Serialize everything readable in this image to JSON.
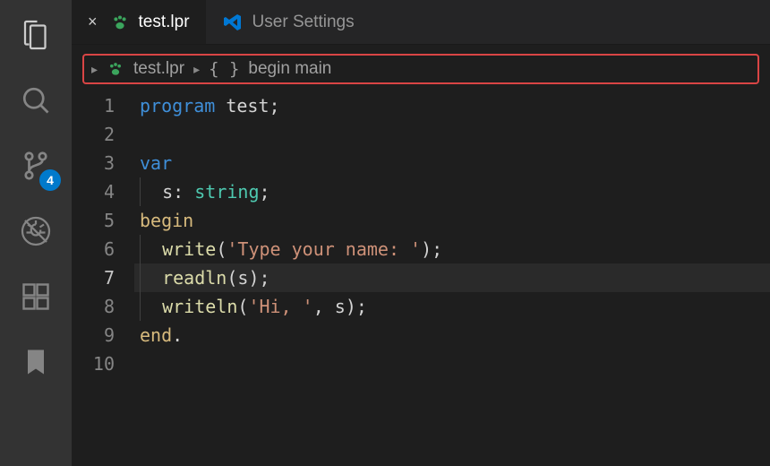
{
  "activity": {
    "scm_badge": "4"
  },
  "tabs": {
    "active": {
      "label": "test.lpr"
    },
    "second": {
      "label": "User Settings"
    }
  },
  "breadcrumb": {
    "file": "test.lpr",
    "symbol": "begin main"
  },
  "gutter": [
    "1",
    "2",
    "3",
    "4",
    "5",
    "6",
    "7",
    "8",
    "9",
    "10"
  ],
  "code": {
    "l1_kw": "program",
    "l1_ident": "test",
    "l1_semi": ";",
    "l3_kw": "var",
    "l4_ident": "s",
    "l4_colon": ": ",
    "l4_type": "string",
    "l4_semi": ";",
    "l5_kw": "begin",
    "l6_fn": "write",
    "l6_open": "(",
    "l6_str": "'Type your name: '",
    "l6_close": ");",
    "l7_fn": "readln",
    "l7_open": "(",
    "l7_arg": "s",
    "l7_close": ");",
    "l8_fn": "writeln",
    "l8_open": "(",
    "l8_str": "'Hi, '",
    "l8_comma": ", ",
    "l8_arg": "s",
    "l8_close": ");",
    "l9_kw": "end",
    "l9_dot": "."
  }
}
